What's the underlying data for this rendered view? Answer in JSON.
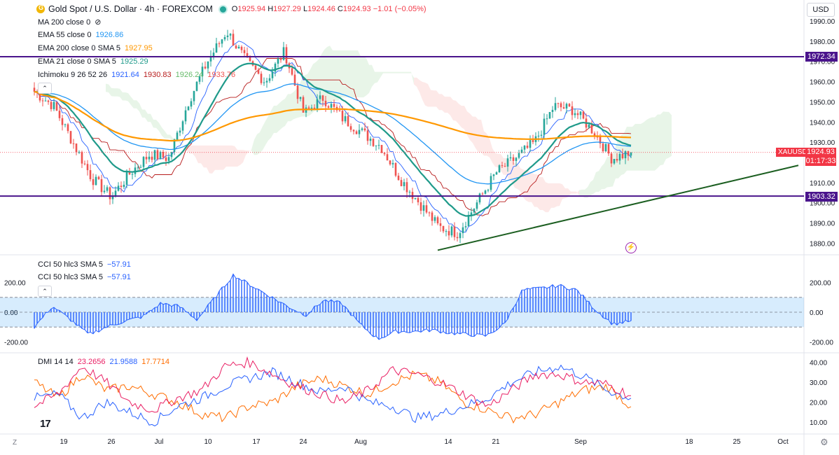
{
  "header": {
    "symbol_title": "Gold Spot / U.S. Dollar · 4h · FOREXCOM",
    "open_label": "O",
    "open": "1925.94",
    "high_label": "H",
    "high": "1927.29",
    "low_label": "L",
    "low": "1924.46",
    "close_label": "C",
    "close": "1924.93",
    "change": "−1.01 (−0.05%)",
    "currency": "USD"
  },
  "indicators": {
    "ma200": "MA 200 close 0",
    "ema55_label": "EMA 55 close 0",
    "ema55_value": "1926.86",
    "ema200_label": "EMA 200 close 0 SMA 5",
    "ema200_value": "1927.95",
    "ema21_label": "EMA 21 close 0 SMA 5",
    "ema21_value": "1925.29",
    "ichimoku_label": "Ichimoku 9 26 52 26",
    "ichimoku_v1": "1921.64",
    "ichimoku_v2": "1930.83",
    "ichimoku_v3": "1926.24",
    "ichimoku_v4": "1933.76"
  },
  "cci": {
    "label1": "CCI 50 hlc3 SMA 5",
    "value1": "−57.91",
    "label2": "CCI 50 hlc3 SMA 5",
    "value2": "−57.91",
    "collapse_symbol": "⌃"
  },
  "dmi": {
    "label": "DMI 14 14",
    "v1": "23.2656",
    "v2": "21.9588",
    "v3": "17.7714"
  },
  "price_tags": {
    "upper_level": "1972.34",
    "lower_level": "1903.32",
    "symbol": "XAUUSD",
    "last_price": "1924.93",
    "countdown": "01:17:33"
  },
  "misc": {
    "logo": "17",
    "zoom_button": "Z",
    "settings_icon": "⚙",
    "alert_icon": "⚡"
  },
  "colors": {
    "up": "#26a69a",
    "down": "#ef5350",
    "ema55": "#2196f3",
    "ema200": "#ff9800",
    "ema21": "#1f9a8a",
    "tenkan": "#2962ff",
    "kijun": "#b71c1c",
    "level": "#4a148c",
    "trend": "#1b5e20",
    "cci": "#2962ff",
    "dmi_plus": "#2962ff",
    "dmi_minus": "#ff6d00",
    "adx": "#e91e63"
  },
  "chart_data": {
    "type": "candlestick",
    "timeframe": "4h",
    "price_axis_ticks": [
      1880,
      1890,
      1900,
      1910,
      1920,
      1930,
      1940,
      1950,
      1960,
      1970,
      1980,
      1990
    ],
    "time_axis_labels": [
      "19",
      "26",
      "Jul",
      "10",
      "17",
      "24",
      "Aug",
      "14",
      "21",
      "Sep",
      "18",
      "25",
      "Oct"
    ],
    "horizontal_levels": [
      1972.34,
      1903.32
    ],
    "trendline": [
      [
        0,
        1876.5
      ],
      [
        1,
        1918.5
      ]
    ],
    "price_path_keypoints": [
      1955,
      1948,
      1930,
      1912,
      1903,
      1915,
      1924,
      1922,
      1950,
      1970,
      1985,
      1970,
      1960,
      1975,
      1944,
      1952,
      1942,
      1935,
      1928,
      1912,
      1900,
      1888,
      1885,
      1900,
      1915,
      1922,
      1930,
      1948,
      1946,
      1936,
      1922,
      1924.93
    ],
    "cci_axis_ticks": [
      200,
      0,
      -200
    ],
    "cci_band": [
      100,
      -100
    ],
    "cci_path_keypoints": [
      -100,
      40,
      -50,
      -150,
      -100,
      -60,
      -30,
      60,
      40,
      -50,
      100,
      250,
      180,
      110,
      40,
      -20,
      80,
      60,
      -80,
      -180,
      -130,
      -130,
      -120,
      -140,
      -150,
      -160,
      -80,
      150,
      160,
      180,
      150,
      20,
      -80,
      -57.91
    ],
    "dmi_axis_ticks": [
      10,
      20,
      30,
      40
    ],
    "dmi_plus_keypoints": [
      22,
      24,
      12,
      20,
      15,
      10,
      18,
      22,
      28,
      32,
      35,
      30,
      25,
      28,
      20,
      18,
      12,
      14,
      18,
      22,
      30,
      35,
      38,
      33,
      26,
      21.9588
    ],
    "dmi_minus_keypoints": [
      30,
      22,
      34,
      26,
      28,
      24,
      20,
      14,
      12,
      18,
      20,
      28,
      32,
      28,
      24,
      30,
      34,
      30,
      20,
      16,
      12,
      14,
      20,
      26,
      28,
      17.7714
    ],
    "adx_keypoints": [
      18,
      24,
      38,
      30,
      20,
      16,
      22,
      26,
      38,
      40,
      34,
      28,
      24,
      20,
      26,
      36,
      34,
      30,
      24,
      18,
      26,
      34,
      34,
      30,
      29,
      23.2656
    ]
  }
}
